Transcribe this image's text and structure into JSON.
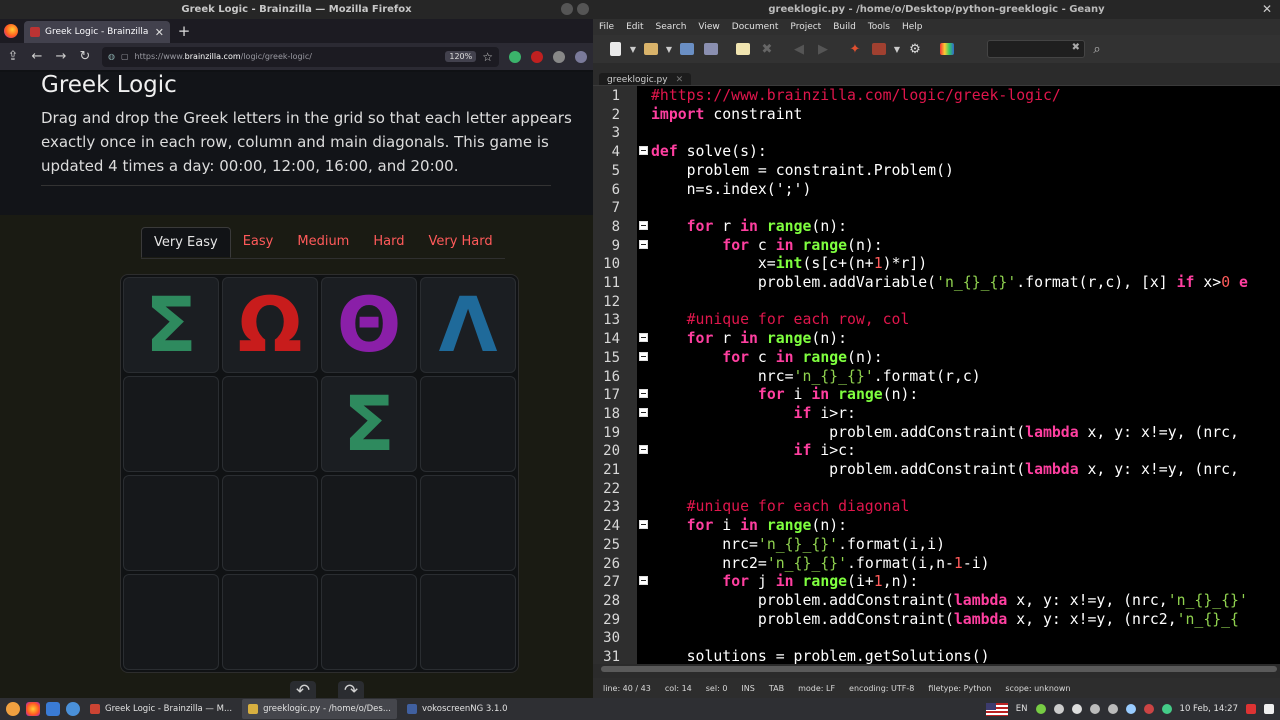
{
  "firefox": {
    "window_title": "Greek Logic - Brainzilla — Mozilla Firefox",
    "tab_title": "Greek Logic - Brainzilla",
    "url_prefix": "https://www.",
    "url_host": "brainzilla.com",
    "url_path": "/logic/greek-logic/",
    "zoom": "120%"
  },
  "page": {
    "title": "Greek Logic",
    "description": "Drag and drop the Greek letters in the grid so that each letter appears exactly once in each row, column and main diagonals. This game is updated 4 times a day: 00:00, 12:00, 16:00, and 20:00.",
    "levels": [
      "Very Easy",
      "Easy",
      "Medium",
      "Hard",
      "Very Hard"
    ],
    "active_level": "Very Easy",
    "grid": [
      [
        {
          "letter": "Σ",
          "color": "#2e8a5e"
        },
        {
          "letter": "Ω",
          "color": "#c81c1c"
        },
        {
          "letter": "Θ",
          "color": "#8a1fa8"
        },
        {
          "letter": "Λ",
          "color": "#1f6a9a"
        }
      ],
      [
        {
          "letter": "",
          "color": ""
        },
        {
          "letter": "",
          "color": ""
        },
        {
          "letter": "Σ",
          "color": "#2e8a5e"
        },
        {
          "letter": "",
          "color": ""
        }
      ],
      [
        {
          "letter": "",
          "color": ""
        },
        {
          "letter": "",
          "color": ""
        },
        {
          "letter": "",
          "color": ""
        },
        {
          "letter": "",
          "color": ""
        }
      ],
      [
        {
          "letter": "",
          "color": ""
        },
        {
          "letter": "",
          "color": ""
        },
        {
          "letter": "",
          "color": ""
        },
        {
          "letter": "",
          "color": ""
        }
      ]
    ],
    "controls": {
      "undo": "↶",
      "redo": "↷"
    }
  },
  "geany": {
    "window_title": "greeklogic.py - /home/o/Desktop/python-greeklogic - Geany",
    "menu": [
      "File",
      "Edit",
      "Search",
      "View",
      "Document",
      "Project",
      "Build",
      "Tools",
      "Help"
    ],
    "file_tab": "greeklogic.py",
    "status": [
      "line: 40 / 43",
      "col: 14",
      "sel: 0",
      "INS",
      "TAB",
      "mode: LF",
      "encoding: UTF-8",
      "filetype: Python",
      "scope: unknown"
    ],
    "code_lines": [
      {
        "n": "1",
        "fold": false,
        "html": "<span class='cm'>#https://www.brainzilla.com/logic/greek-logic/</span>"
      },
      {
        "n": "2",
        "fold": false,
        "html": "<span class='kw'>import</span> constraint"
      },
      {
        "n": "3",
        "fold": false,
        "html": ""
      },
      {
        "n": "4",
        "fold": true,
        "html": "<span class='kw'>def</span> solve(s):"
      },
      {
        "n": "5",
        "fold": false,
        "html": "    problem = constraint.Problem()"
      },
      {
        "n": "6",
        "fold": false,
        "html": "    n=s.index(';')"
      },
      {
        "n": "7",
        "fold": false,
        "html": ""
      },
      {
        "n": "8",
        "fold": true,
        "html": "    <span class='kw'>for</span> r <span class='kw'>in</span> <span class='bi'>range</span>(n):"
      },
      {
        "n": "9",
        "fold": true,
        "html": "        <span class='kw'>for</span> c <span class='kw'>in</span> <span class='bi'>range</span>(n):"
      },
      {
        "n": "10",
        "fold": false,
        "html": "            x=<span class='bi'>int</span>(s[c+(n+<span class='nm'>1</span>)*r])"
      },
      {
        "n": "11",
        "fold": false,
        "html": "            problem.addVariable(<span class='st'>'n_{}_{}'</span>.format(r,c), [x] <span class='kw'>if</span> x&gt;<span class='nm'>0</span> <span class='kw'>e</span>"
      },
      {
        "n": "12",
        "fold": false,
        "html": ""
      },
      {
        "n": "13",
        "fold": false,
        "html": "    <span class='cm'>#unique for each row, col</span>"
      },
      {
        "n": "14",
        "fold": true,
        "html": "    <span class='kw'>for</span> r <span class='kw'>in</span> <span class='bi'>range</span>(n):"
      },
      {
        "n": "15",
        "fold": true,
        "html": "        <span class='kw'>for</span> c <span class='kw'>in</span> <span class='bi'>range</span>(n):"
      },
      {
        "n": "16",
        "fold": false,
        "html": "            nrc=<span class='st'>'n_{}_{}'</span>.format(r,c)"
      },
      {
        "n": "17",
        "fold": true,
        "html": "            <span class='kw'>for</span> i <span class='kw'>in</span> <span class='bi'>range</span>(n):"
      },
      {
        "n": "18",
        "fold": true,
        "html": "                <span class='kw'>if</span> i&gt;r:"
      },
      {
        "n": "19",
        "fold": false,
        "html": "                    problem.addConstraint(<span class='kw'>lambda</span> x, y: x!=y, (nrc,"
      },
      {
        "n": "20",
        "fold": true,
        "html": "                <span class='kw'>if</span> i&gt;c:"
      },
      {
        "n": "21",
        "fold": false,
        "html": "                    problem.addConstraint(<span class='kw'>lambda</span> x, y: x!=y, (nrc,"
      },
      {
        "n": "22",
        "fold": false,
        "html": ""
      },
      {
        "n": "23",
        "fold": false,
        "html": "    <span class='cm'>#unique for each diagonal</span>"
      },
      {
        "n": "24",
        "fold": true,
        "html": "    <span class='kw'>for</span> i <span class='kw'>in</span> <span class='bi'>range</span>(n):"
      },
      {
        "n": "25",
        "fold": false,
        "html": "        nrc=<span class='st'>'n_{}_{}'</span>.format(i,i)"
      },
      {
        "n": "26",
        "fold": false,
        "html": "        nrc2=<span class='st'>'n_{}_{}'</span>.format(i,n-<span class='nm'>1</span>-i)"
      },
      {
        "n": "27",
        "fold": true,
        "html": "        <span class='kw'>for</span> j <span class='kw'>in</span> <span class='bi'>range</span>(i+<span class='nm'>1</span>,n):"
      },
      {
        "n": "28",
        "fold": false,
        "html": "            problem.addConstraint(<span class='kw'>lambda</span> x, y: x!=y, (nrc,<span class='st'>'n_{}_{}'</span>"
      },
      {
        "n": "29",
        "fold": false,
        "html": "            problem.addConstraint(<span class='kw'>lambda</span> x, y: x!=y, (nrc2,<span class='st'>'n_{}_{</span>"
      },
      {
        "n": "30",
        "fold": false,
        "html": ""
      },
      {
        "n": "31",
        "fold": false,
        "html": "    solutions = problem.getSolutions()"
      }
    ]
  },
  "taskbar": {
    "tasks": [
      "Greek Logic - Brainzilla — M...",
      "greeklogic.py - /home/o/Des...",
      "vokoscreenNG 3.1.0"
    ],
    "keyboard_layout": "EN",
    "clock": "10 Feb, 14:27"
  }
}
